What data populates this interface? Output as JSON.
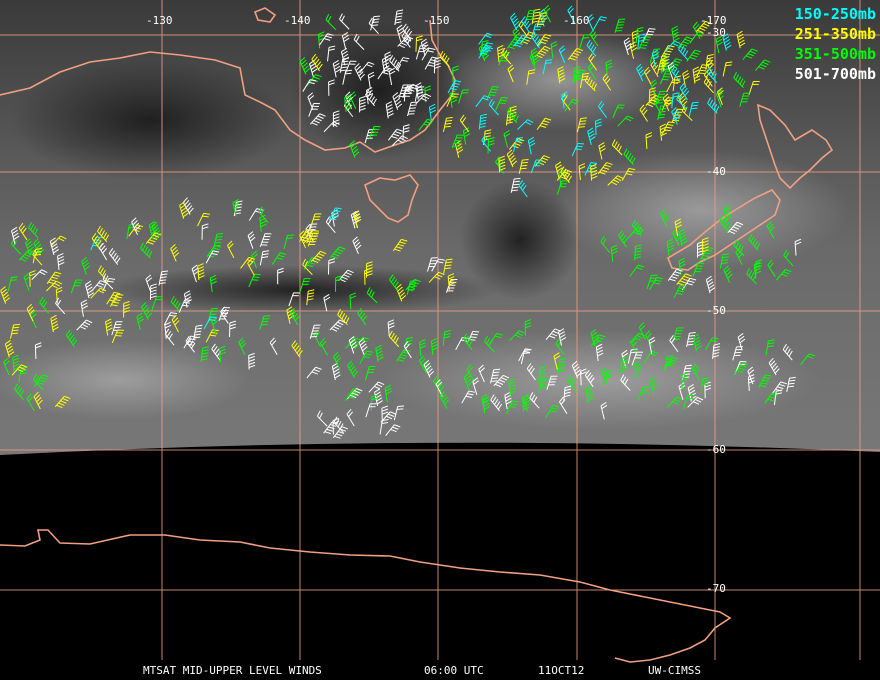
{
  "legend": [
    {
      "label": "150-250mb",
      "color": "#00ffff"
    },
    {
      "label": "251-350mb",
      "color": "#ffff00"
    },
    {
      "label": "351-500mb",
      "color": "#00ff00"
    },
    {
      "label": "501-700mb",
      "color": "#ffffff"
    }
  ],
  "longitude_labels": [
    "-130",
    "-140",
    "-150",
    "-160",
    "-170"
  ],
  "latitude_labels": [
    "-30",
    "-40",
    "-50",
    "-60",
    "-70"
  ],
  "footer": {
    "product": "MTSAT MID-UPPER LEVEL WINDS",
    "time": "06:00 UTC",
    "date": "11OCT12",
    "source": "UW-CIMSS"
  },
  "colors": {
    "coastline": "#f0a080",
    "grid": "#e8a080",
    "background": "#000000"
  }
}
